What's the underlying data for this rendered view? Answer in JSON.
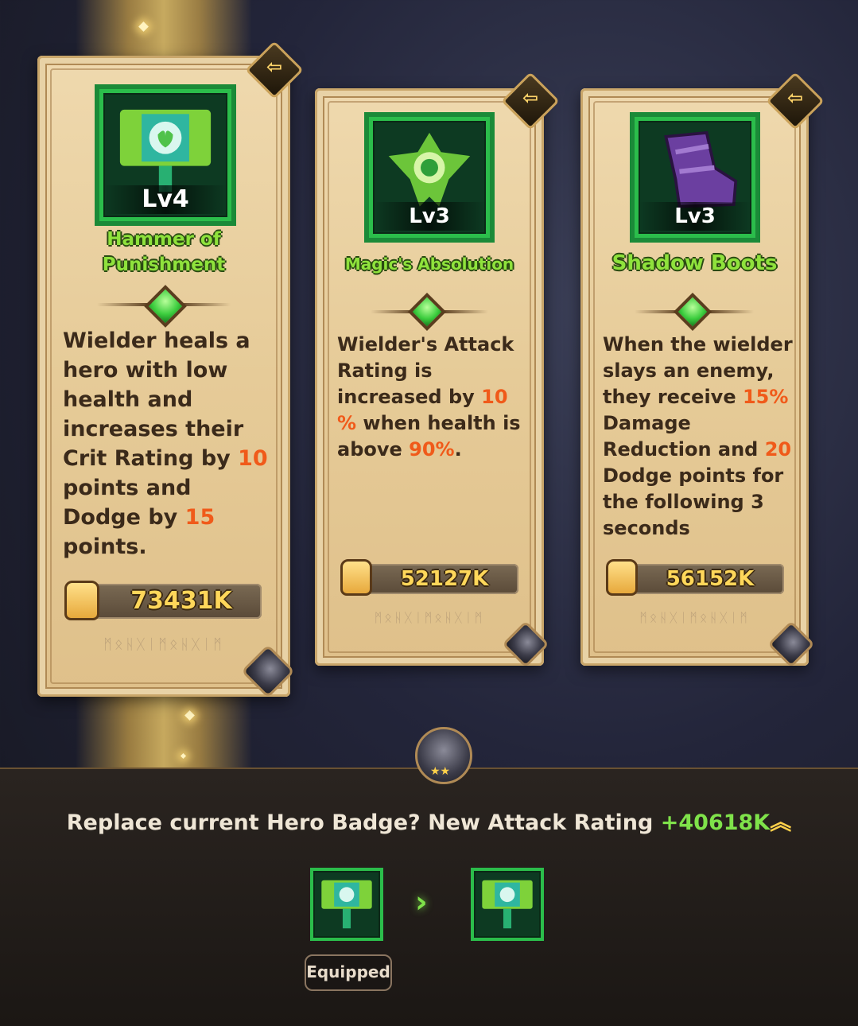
{
  "cards": [
    {
      "level": "Lv4",
      "name_line1": "Hammer of",
      "name_line2": "Punishment",
      "desc_segments": [
        {
          "t": "Wielder heals a hero with low health and increases their Crit Rating by ",
          "h": false
        },
        {
          "t": "10",
          "h": true
        },
        {
          "t": " points and Dodge by ",
          "h": false
        },
        {
          "t": "15",
          "h": true
        },
        {
          "t": " points.",
          "h": false
        }
      ],
      "power": "73431K",
      "runes": "ᛗᛟᚺᚷᛁᛗᛟᚺᚷᛁᛗ",
      "icon": "hammer-badge-icon",
      "hero": "hero-portrait-knight"
    },
    {
      "level": "Lv3",
      "name": "Magic's Absolution",
      "desc_segments": [
        {
          "t": "Wielder's Attack Rating is increased by ",
          "h": false
        },
        {
          "t": "10 %",
          "h": true
        },
        {
          "t": " when health is above ",
          "h": false
        },
        {
          "t": "90%",
          "h": true
        },
        {
          "t": ".",
          "h": false
        }
      ],
      "power": "52127K",
      "runes": "ᛗᛟᚺᚷᛁᛗᛟᚺᚷᛁᛗ",
      "icon": "emblem-badge-icon",
      "hero": "hero-portrait-mage"
    },
    {
      "level": "Lv3",
      "name": "Shadow Boots",
      "desc_segments": [
        {
          "t": "When the wielder slays an enemy, they receive ",
          "h": false
        },
        {
          "t": "15%",
          "h": true
        },
        {
          "t": " Damage Reduction and ",
          "h": false
        },
        {
          "t": "20",
          "h": true
        },
        {
          "t": " Dodge points for the following 3 seconds",
          "h": false
        }
      ],
      "power": "56152K",
      "runes": "ᛗᛟᚺᚷᛁᛗᛟᚺᚷᛁᛗ",
      "icon": "boots-badge-icon",
      "hero": "hero-portrait-rogue"
    }
  ],
  "prompt": {
    "text": "Replace current Hero Badge? New Attack Rating ",
    "delta": "+40618K"
  },
  "equipped_label": "Equipped",
  "colors": {
    "highlight": "#f05a1a",
    "name_green": "#8fe23c",
    "power_gold": "#ffd75a",
    "frame_green": "#2bbd4b"
  }
}
